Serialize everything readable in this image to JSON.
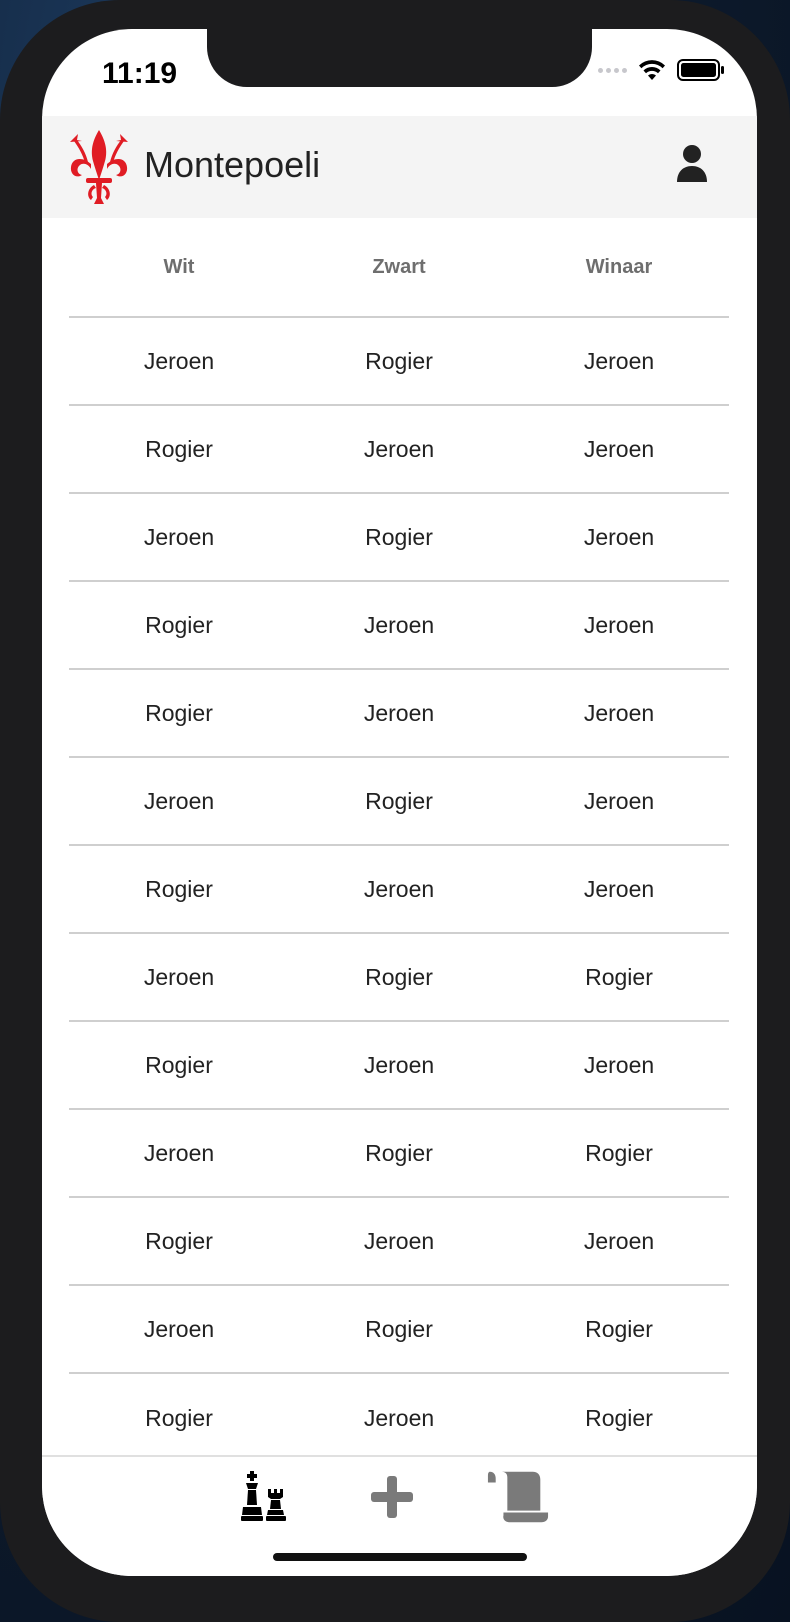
{
  "status_bar": {
    "time": "11:19"
  },
  "app": {
    "title": "Montepoeli"
  },
  "table": {
    "columns": [
      "Wit",
      "Zwart",
      "Winaar"
    ],
    "rows": [
      [
        "Jeroen",
        "Rogier",
        "Jeroen"
      ],
      [
        "Rogier",
        "Jeroen",
        "Jeroen"
      ],
      [
        "Jeroen",
        "Rogier",
        "Jeroen"
      ],
      [
        "Rogier",
        "Jeroen",
        "Jeroen"
      ],
      [
        "Rogier",
        "Jeroen",
        "Jeroen"
      ],
      [
        "Jeroen",
        "Rogier",
        "Jeroen"
      ],
      [
        "Rogier",
        "Jeroen",
        "Jeroen"
      ],
      [
        "Jeroen",
        "Rogier",
        "Rogier"
      ],
      [
        "Rogier",
        "Jeroen",
        "Jeroen"
      ],
      [
        "Jeroen",
        "Rogier",
        "Rogier"
      ],
      [
        "Rogier",
        "Jeroen",
        "Jeroen"
      ],
      [
        "Jeroen",
        "Rogier",
        "Rogier"
      ],
      [
        "Rogier",
        "Jeroen",
        "Rogier"
      ]
    ]
  },
  "tabs": [
    {
      "icon": "chess-pieces-icon",
      "active": true
    },
    {
      "icon": "plus-icon",
      "active": false
    },
    {
      "icon": "scroll-icon",
      "active": false
    }
  ],
  "colors": {
    "logo_red": "#e01c24",
    "active_tab": "#000000",
    "inactive_tab": "#7a7a7a"
  }
}
